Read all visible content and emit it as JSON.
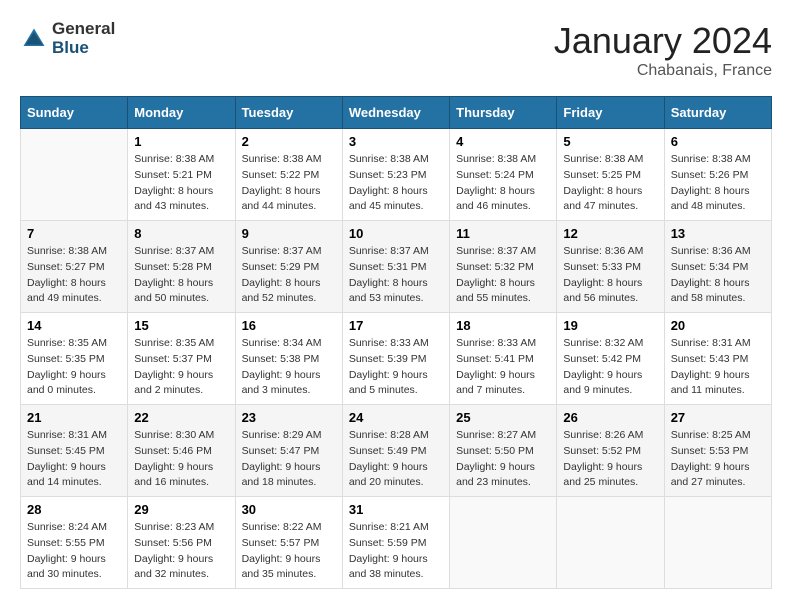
{
  "header": {
    "logo_general": "General",
    "logo_blue": "Blue",
    "month_year": "January 2024",
    "location": "Chabanais, France"
  },
  "days_of_week": [
    "Sunday",
    "Monday",
    "Tuesday",
    "Wednesday",
    "Thursday",
    "Friday",
    "Saturday"
  ],
  "weeks": [
    [
      {
        "day": "",
        "sunrise": "",
        "sunset": "",
        "daylight": ""
      },
      {
        "day": "1",
        "sunrise": "8:38 AM",
        "sunset": "5:21 PM",
        "daylight": "8 hours and 43 minutes."
      },
      {
        "day": "2",
        "sunrise": "8:38 AM",
        "sunset": "5:22 PM",
        "daylight": "8 hours and 44 minutes."
      },
      {
        "day": "3",
        "sunrise": "8:38 AM",
        "sunset": "5:23 PM",
        "daylight": "8 hours and 45 minutes."
      },
      {
        "day": "4",
        "sunrise": "8:38 AM",
        "sunset": "5:24 PM",
        "daylight": "8 hours and 46 minutes."
      },
      {
        "day": "5",
        "sunrise": "8:38 AM",
        "sunset": "5:25 PM",
        "daylight": "8 hours and 47 minutes."
      },
      {
        "day": "6",
        "sunrise": "8:38 AM",
        "sunset": "5:26 PM",
        "daylight": "8 hours and 48 minutes."
      }
    ],
    [
      {
        "day": "7",
        "sunrise": "8:38 AM",
        "sunset": "5:27 PM",
        "daylight": "8 hours and 49 minutes."
      },
      {
        "day": "8",
        "sunrise": "8:37 AM",
        "sunset": "5:28 PM",
        "daylight": "8 hours and 50 minutes."
      },
      {
        "day": "9",
        "sunrise": "8:37 AM",
        "sunset": "5:29 PM",
        "daylight": "8 hours and 52 minutes."
      },
      {
        "day": "10",
        "sunrise": "8:37 AM",
        "sunset": "5:31 PM",
        "daylight": "8 hours and 53 minutes."
      },
      {
        "day": "11",
        "sunrise": "8:37 AM",
        "sunset": "5:32 PM",
        "daylight": "8 hours and 55 minutes."
      },
      {
        "day": "12",
        "sunrise": "8:36 AM",
        "sunset": "5:33 PM",
        "daylight": "8 hours and 56 minutes."
      },
      {
        "day": "13",
        "sunrise": "8:36 AM",
        "sunset": "5:34 PM",
        "daylight": "8 hours and 58 minutes."
      }
    ],
    [
      {
        "day": "14",
        "sunrise": "8:35 AM",
        "sunset": "5:35 PM",
        "daylight": "9 hours and 0 minutes."
      },
      {
        "day": "15",
        "sunrise": "8:35 AM",
        "sunset": "5:37 PM",
        "daylight": "9 hours and 2 minutes."
      },
      {
        "day": "16",
        "sunrise": "8:34 AM",
        "sunset": "5:38 PM",
        "daylight": "9 hours and 3 minutes."
      },
      {
        "day": "17",
        "sunrise": "8:33 AM",
        "sunset": "5:39 PM",
        "daylight": "9 hours and 5 minutes."
      },
      {
        "day": "18",
        "sunrise": "8:33 AM",
        "sunset": "5:41 PM",
        "daylight": "9 hours and 7 minutes."
      },
      {
        "day": "19",
        "sunrise": "8:32 AM",
        "sunset": "5:42 PM",
        "daylight": "9 hours and 9 minutes."
      },
      {
        "day": "20",
        "sunrise": "8:31 AM",
        "sunset": "5:43 PM",
        "daylight": "9 hours and 11 minutes."
      }
    ],
    [
      {
        "day": "21",
        "sunrise": "8:31 AM",
        "sunset": "5:45 PM",
        "daylight": "9 hours and 14 minutes."
      },
      {
        "day": "22",
        "sunrise": "8:30 AM",
        "sunset": "5:46 PM",
        "daylight": "9 hours and 16 minutes."
      },
      {
        "day": "23",
        "sunrise": "8:29 AM",
        "sunset": "5:47 PM",
        "daylight": "9 hours and 18 minutes."
      },
      {
        "day": "24",
        "sunrise": "8:28 AM",
        "sunset": "5:49 PM",
        "daylight": "9 hours and 20 minutes."
      },
      {
        "day": "25",
        "sunrise": "8:27 AM",
        "sunset": "5:50 PM",
        "daylight": "9 hours and 23 minutes."
      },
      {
        "day": "26",
        "sunrise": "8:26 AM",
        "sunset": "5:52 PM",
        "daylight": "9 hours and 25 minutes."
      },
      {
        "day": "27",
        "sunrise": "8:25 AM",
        "sunset": "5:53 PM",
        "daylight": "9 hours and 27 minutes."
      }
    ],
    [
      {
        "day": "28",
        "sunrise": "8:24 AM",
        "sunset": "5:55 PM",
        "daylight": "9 hours and 30 minutes."
      },
      {
        "day": "29",
        "sunrise": "8:23 AM",
        "sunset": "5:56 PM",
        "daylight": "9 hours and 32 minutes."
      },
      {
        "day": "30",
        "sunrise": "8:22 AM",
        "sunset": "5:57 PM",
        "daylight": "9 hours and 35 minutes."
      },
      {
        "day": "31",
        "sunrise": "8:21 AM",
        "sunset": "5:59 PM",
        "daylight": "9 hours and 38 minutes."
      },
      {
        "day": "",
        "sunrise": "",
        "sunset": "",
        "daylight": ""
      },
      {
        "day": "",
        "sunrise": "",
        "sunset": "",
        "daylight": ""
      },
      {
        "day": "",
        "sunrise": "",
        "sunset": "",
        "daylight": ""
      }
    ]
  ],
  "labels": {
    "sunrise_prefix": "Sunrise: ",
    "sunset_prefix": "Sunset: ",
    "daylight_prefix": "Daylight: "
  }
}
